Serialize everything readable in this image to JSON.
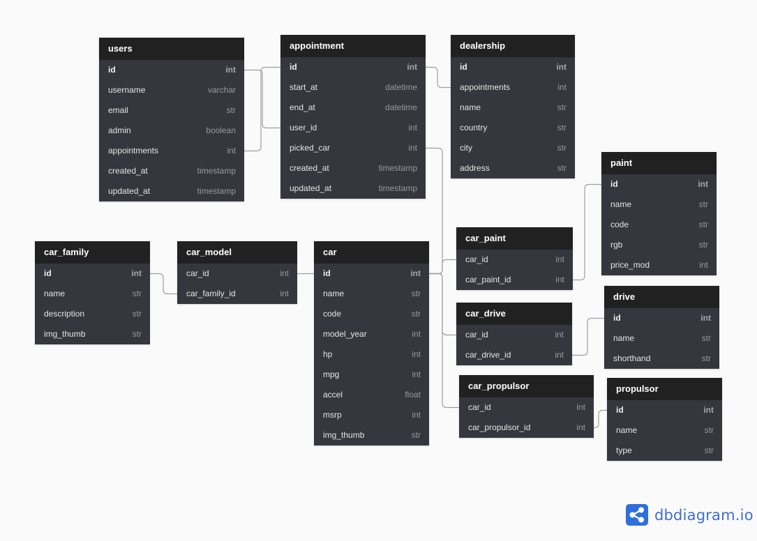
{
  "tables": {
    "users": {
      "name": "users",
      "fields": [
        {
          "name": "id",
          "type": "int",
          "pk": true
        },
        {
          "name": "username",
          "type": "varchar"
        },
        {
          "name": "email",
          "type": "str"
        },
        {
          "name": "admin",
          "type": "boolean"
        },
        {
          "name": "appointments",
          "type": "int"
        },
        {
          "name": "created_at",
          "type": "timestamp"
        },
        {
          "name": "updated_at",
          "type": "timestamp"
        }
      ]
    },
    "appointment": {
      "name": "appointment",
      "fields": [
        {
          "name": "id",
          "type": "int",
          "pk": true
        },
        {
          "name": "start_at",
          "type": "datetime"
        },
        {
          "name": "end_at",
          "type": "datetime"
        },
        {
          "name": "user_id",
          "type": "int"
        },
        {
          "name": "picked_car",
          "type": "int"
        },
        {
          "name": "created_at",
          "type": "timestamp"
        },
        {
          "name": "updated_at",
          "type": "timestamp"
        }
      ]
    },
    "dealership": {
      "name": "dealership",
      "fields": [
        {
          "name": "id",
          "type": "int",
          "pk": true
        },
        {
          "name": "appointments",
          "type": "int"
        },
        {
          "name": "name",
          "type": "str"
        },
        {
          "name": "country",
          "type": "str"
        },
        {
          "name": "city",
          "type": "str"
        },
        {
          "name": "address",
          "type": "str"
        }
      ]
    },
    "paint": {
      "name": "paint",
      "fields": [
        {
          "name": "id",
          "type": "int",
          "pk": true
        },
        {
          "name": "name",
          "type": "str"
        },
        {
          "name": "code",
          "type": "str"
        },
        {
          "name": "rgb",
          "type": "str"
        },
        {
          "name": "price_mod",
          "type": "int"
        }
      ]
    },
    "car_family": {
      "name": "car_family",
      "fields": [
        {
          "name": "id",
          "type": "int",
          "pk": true
        },
        {
          "name": "name",
          "type": "str"
        },
        {
          "name": "description",
          "type": "str"
        },
        {
          "name": "img_thumb",
          "type": "str"
        }
      ]
    },
    "car_model": {
      "name": "car_model",
      "fields": [
        {
          "name": "car_id",
          "type": "int"
        },
        {
          "name": "car_family_id",
          "type": "int"
        }
      ]
    },
    "car": {
      "name": "car",
      "fields": [
        {
          "name": "id",
          "type": "int",
          "pk": true
        },
        {
          "name": "name",
          "type": "str"
        },
        {
          "name": "code",
          "type": "str"
        },
        {
          "name": "model_year",
          "type": "int"
        },
        {
          "name": "hp",
          "type": "int"
        },
        {
          "name": "mpg",
          "type": "int"
        },
        {
          "name": "accel",
          "type": "float"
        },
        {
          "name": "msrp",
          "type": "int"
        },
        {
          "name": "img_thumb",
          "type": "str"
        }
      ]
    },
    "car_paint": {
      "name": "car_paint",
      "fields": [
        {
          "name": "car_id",
          "type": "int"
        },
        {
          "name": "car_paint_id",
          "type": "int"
        }
      ]
    },
    "car_drive": {
      "name": "car_drive",
      "fields": [
        {
          "name": "car_id",
          "type": "int"
        },
        {
          "name": "car_drive_id",
          "type": "int"
        }
      ]
    },
    "car_propulsor": {
      "name": "car_propulsor",
      "fields": [
        {
          "name": "car_id",
          "type": "int"
        },
        {
          "name": "car_propulsor_id",
          "type": "int"
        }
      ]
    },
    "drive": {
      "name": "drive",
      "fields": [
        {
          "name": "id",
          "type": "int",
          "pk": true
        },
        {
          "name": "name",
          "type": "str"
        },
        {
          "name": "shorthand",
          "type": "str"
        }
      ]
    },
    "propulsor": {
      "name": "propulsor",
      "fields": [
        {
          "name": "id",
          "type": "int",
          "pk": true
        },
        {
          "name": "name",
          "type": "str"
        },
        {
          "name": "type",
          "type": "str"
        }
      ]
    }
  },
  "relationships": [
    {
      "from": "users.id",
      "to": "appointment.user_id"
    },
    {
      "from": "users.appointments",
      "to": "appointment.id"
    },
    {
      "from": "appointment.id",
      "to": "dealership.appointments"
    },
    {
      "from": "appointment.picked_car",
      "to": "car.id"
    },
    {
      "from": "car_family.id",
      "to": "car_model.car_family_id"
    },
    {
      "from": "car_model.car_id",
      "to": "car.id"
    },
    {
      "from": "car.id",
      "to": "car_paint.car_id"
    },
    {
      "from": "car.id",
      "to": "car_drive.car_id"
    },
    {
      "from": "car.id",
      "to": "car_propulsor.car_id"
    },
    {
      "from": "car_paint.car_paint_id",
      "to": "paint.id"
    },
    {
      "from": "car_drive.car_drive_id",
      "to": "drive.id"
    },
    {
      "from": "car_propulsor.car_propulsor_id",
      "to": "propulsor.id"
    }
  ],
  "brand": {
    "name": "dbdiagram.io",
    "icon": "share-icon",
    "color": "#2f6fdc"
  },
  "colors": {
    "header": "#212121",
    "body": "#35363e",
    "canvas": "#fafafa",
    "link": "#9e9e9e"
  }
}
